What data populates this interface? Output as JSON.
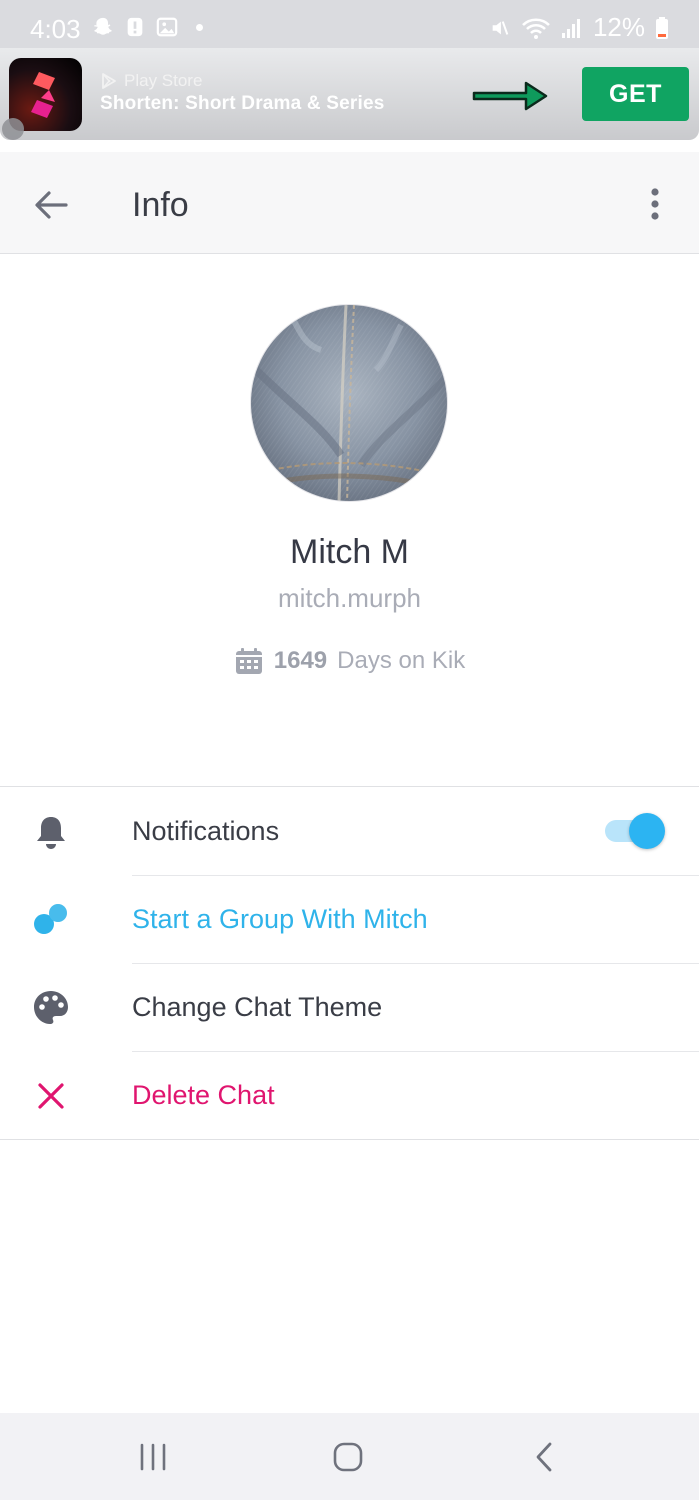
{
  "status_bar": {
    "time": "4:03",
    "battery": "12%"
  },
  "ad": {
    "source": "Play Store",
    "title": "Shorten: Short Drama & Series",
    "cta": "GET",
    "cta_color": "#10a462",
    "arrow_color": "#0f9a5c"
  },
  "header": {
    "title": "Info",
    "back_icon": "back-arrow-icon",
    "menu_icon": "more-vertical-icon"
  },
  "profile": {
    "name": "Mitch M",
    "username": "mitch.murph",
    "days_count": "1649",
    "days_label": "Days on Kik",
    "days_icon": "calendar-icon"
  },
  "options": [
    {
      "label": "Notifications",
      "icon": "bell-icon",
      "toggle_on": true
    },
    {
      "label": "Start a Group With Mitch",
      "icon": "group-icon"
    },
    {
      "label": "Change Chat Theme",
      "icon": "palette-icon"
    },
    {
      "label": "Delete Chat",
      "icon": "close-icon"
    }
  ],
  "colors": {
    "accent_blue": "#2fb3ea",
    "danger_pink": "#e0156f",
    "text_dark": "#3a3d46",
    "text_muted": "#a9acb6"
  }
}
